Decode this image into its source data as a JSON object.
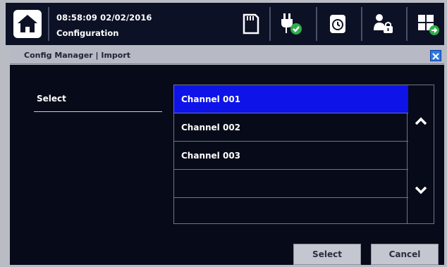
{
  "header": {
    "datetime": "08:58:09 02/02/2016",
    "subtitle": "Configuration",
    "icons": [
      "home-icon",
      "sd-card-icon",
      "power-plug-check-icon",
      "alarm-clock-icon",
      "user-lock-icon",
      "grid-export-icon"
    ]
  },
  "dialog": {
    "title": "Config Manager | Import",
    "close_icon": "close-icon"
  },
  "form": {
    "select_label": "Select"
  },
  "list": {
    "items": [
      "Channel 001",
      "Channel 002",
      "Channel 003",
      "",
      ""
    ],
    "selected_index": 0,
    "scroll_up_icon": "chevron-up-icon",
    "scroll_down_icon": "chevron-down-icon"
  },
  "buttons": {
    "select": "Select",
    "cancel": "Cancel"
  },
  "colors": {
    "selected_row": "#0e14e8",
    "background": "#070a18",
    "chrome": "#b9bcc3"
  }
}
